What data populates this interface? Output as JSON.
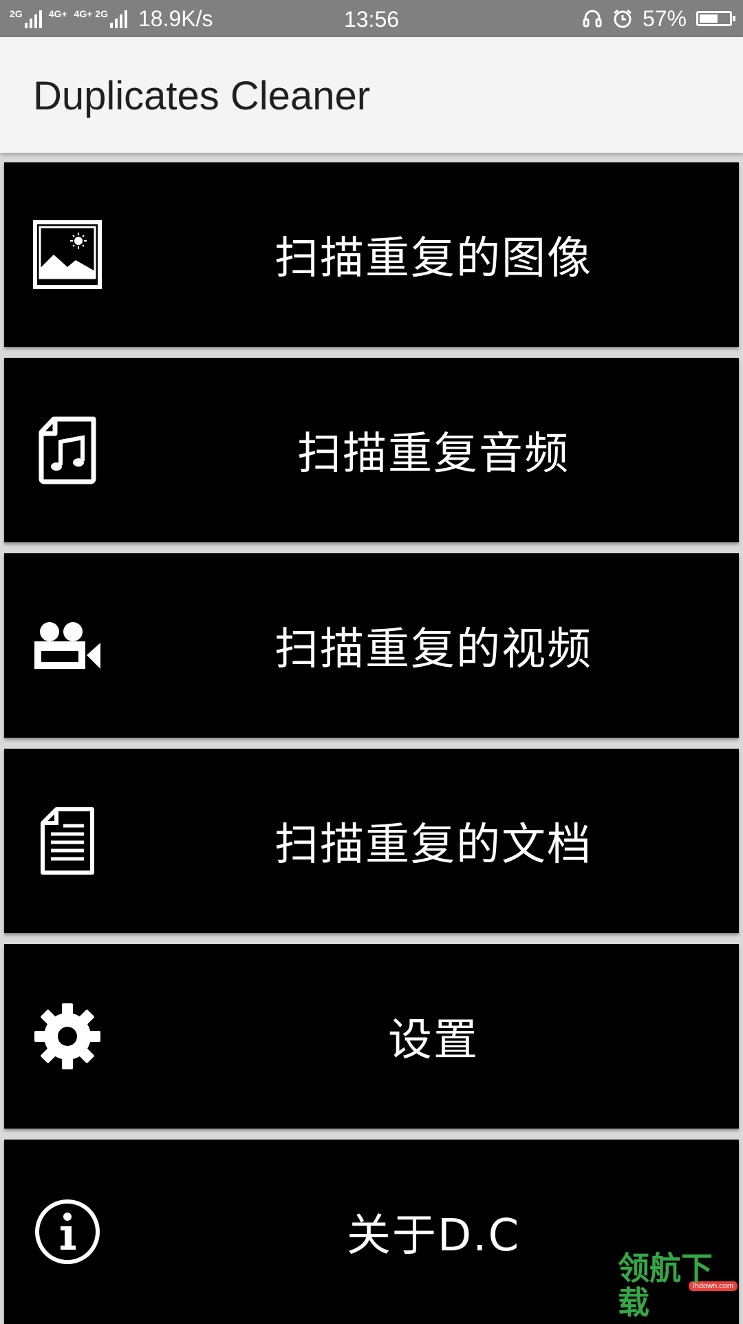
{
  "status_bar": {
    "network_labels": [
      "2G",
      "4G+",
      "4G+ 2G"
    ],
    "speed": "18.9K/s",
    "time": "13:56",
    "battery": "57%",
    "battery_level": 0.57
  },
  "app_bar": {
    "title": "Duplicates Cleaner"
  },
  "menu": {
    "items": [
      {
        "label": "扫描重复的图像",
        "icon": "image-icon"
      },
      {
        "label": "扫描重复音频",
        "icon": "music-file-icon"
      },
      {
        "label": "扫描重复的视频",
        "icon": "video-camera-icon"
      },
      {
        "label": "扫描重复的文档",
        "icon": "document-icon"
      },
      {
        "label": "设置",
        "icon": "gear-icon"
      },
      {
        "label": "关于D.C",
        "icon": "info-icon"
      }
    ]
  },
  "watermark": {
    "brand": "领航下载",
    "site": "lhdown.com"
  },
  "colors": {
    "status_bar": "#808080",
    "app_bar": "#f4f4f4",
    "item_bg": "#000000",
    "item_fg": "#ffffff",
    "watermark": "#35a845"
  }
}
